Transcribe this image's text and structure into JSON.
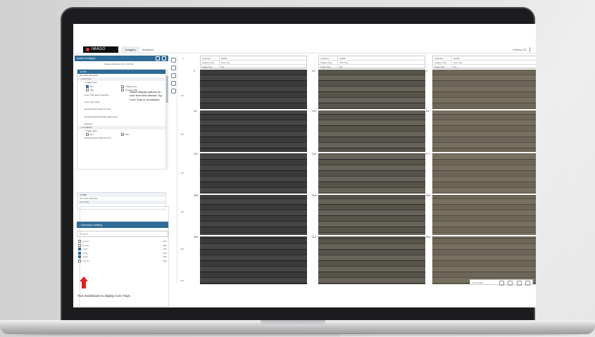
{
  "app": {
    "logo": "IMAGO",
    "tabs": [
      {
        "label": "Imagery",
        "active": true
      },
      {
        "label": "Analytics",
        "active": false
      }
    ],
    "editing": "Editing Off"
  },
  "left_panel": {
    "title": "Active Imagery",
    "subtitle": "Display attributes from CSV file",
    "tree": {
      "hole_label": "HL098",
      "no_label": "(No label assigned)",
      "core_tray": "Core Tray",
      "image_types": "Image types",
      "options": [
        "Dry",
        "Original_Dry",
        "Wet",
        "Original_Wet"
      ],
      "items": [
        "Core Tray Name Numbers",
        "Core Tray Label",
        "Geotechnical Codes of Core",
        "Geotechnical Recorded Statements",
        "Features"
      ],
      "unrealized": "Unrealized",
      "ut_types": "Image types",
      "ut_options": [
        "Dry",
        "Wet"
      ],
      "ut_item": "Geotechnical Codes of Core"
    },
    "note": "Select display options for core from this window. Eg. Core Tray or Unrealised",
    "tree2": {
      "hole_label": "HL098",
      "no_label": "(No label assigned)",
      "core_tray": "Core Tray"
    },
    "dataset": {
      "title": "Diamond Drilling",
      "search_placeholder": "Search",
      "rows": [
        {
          "name": "RC1014",
          "checked": false,
          "date": "1985"
        },
        {
          "name": "RC2901",
          "checked": false,
          "date": "1985"
        },
        {
          "name": "HL097",
          "checked": true,
          "date": "1985"
        },
        {
          "name": "HL098",
          "checked": true,
          "date": "1985"
        },
        {
          "name": "HL099",
          "checked": true,
          "date": "1985"
        },
        {
          "name": "RC3150",
          "checked": false,
          "date": "1985"
        }
      ]
    },
    "tick_note": "Tick checkboxes to display Core Trays"
  },
  "axis_labels": [
    "0",
    "100",
    "200",
    "300",
    "400",
    "500",
    "600"
  ],
  "columns": [
    {
      "collection": "HL098",
      "image_type": "Core Tray",
      "image_date": "Dry",
      "depths": [
        "0",
        "9.6",
        "19.0",
        "29.8",
        "39.8"
      ],
      "tone": "dark"
    },
    {
      "collection": "HL098",
      "image_type": "Core Tray",
      "image_date": "Dry",
      "depths": [
        "6.3",
        "14.3",
        "23.5",
        "32.8",
        "41.5"
      ],
      "tone": "mid"
    },
    {
      "collection": "HL098",
      "image_type": "Core Tray",
      "image_date": "Dry",
      "depths": [
        "0",
        "8.5",
        "17.7",
        "26.6",
        "36.2"
      ],
      "tone": "light"
    }
  ],
  "bottom_bar": {
    "zoom": "Fit to width"
  },
  "colors": {
    "accent": "#2f6b96",
    "arrow": "#e02020"
  }
}
